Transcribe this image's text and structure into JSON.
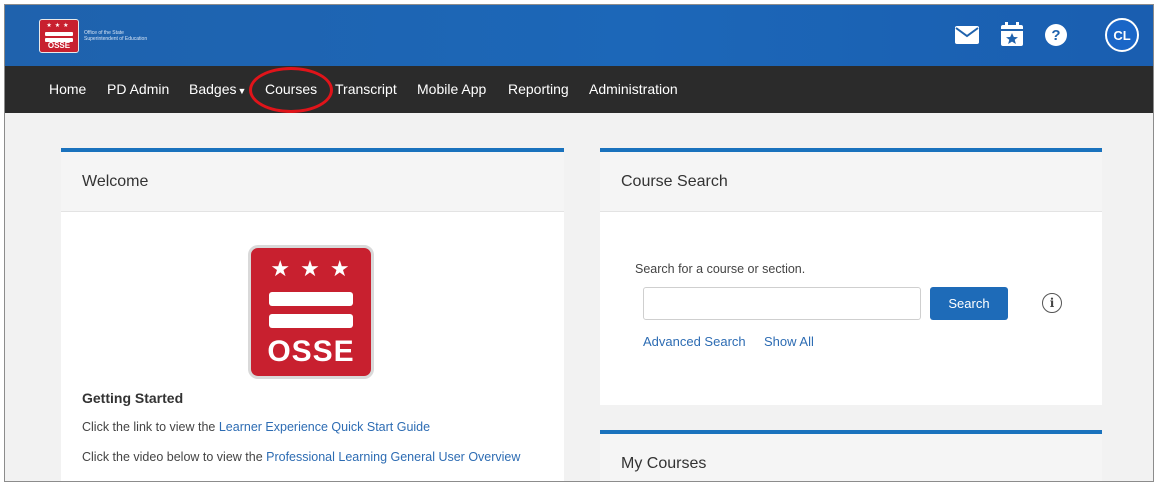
{
  "header": {
    "logo_text": "OSSE",
    "logo_org": "Office of the State Superintendent of Education",
    "icons": [
      "mail-icon",
      "calendar-star-icon",
      "help-icon"
    ],
    "help_glyph": "?",
    "avatar_initials": "CL",
    "brand_color": "#1f62ad"
  },
  "nav": {
    "items": [
      "Home",
      "PD Admin",
      "Badges",
      "Courses",
      "Transcript",
      "Mobile App",
      "Reporting",
      "Administration"
    ],
    "highlighted": "Courses",
    "highlight_color": "#e0141a"
  },
  "welcome": {
    "title": "Welcome",
    "logo_text": "OSSE",
    "getting_started": "Getting Started",
    "line1_prefix": "Click the link to view the ",
    "line1_link": "Learner Experience Quick Start Guide",
    "line2_prefix": "Click the video below to view the ",
    "line2_link": "Professional Learning General User Overview"
  },
  "course_search": {
    "title": "Course Search",
    "label": "Search for a course or section.",
    "input_value": "",
    "button": "Search",
    "advanced_link": "Advanced Search",
    "show_all_link": "Show All"
  },
  "my_courses": {
    "title": "My Courses"
  }
}
